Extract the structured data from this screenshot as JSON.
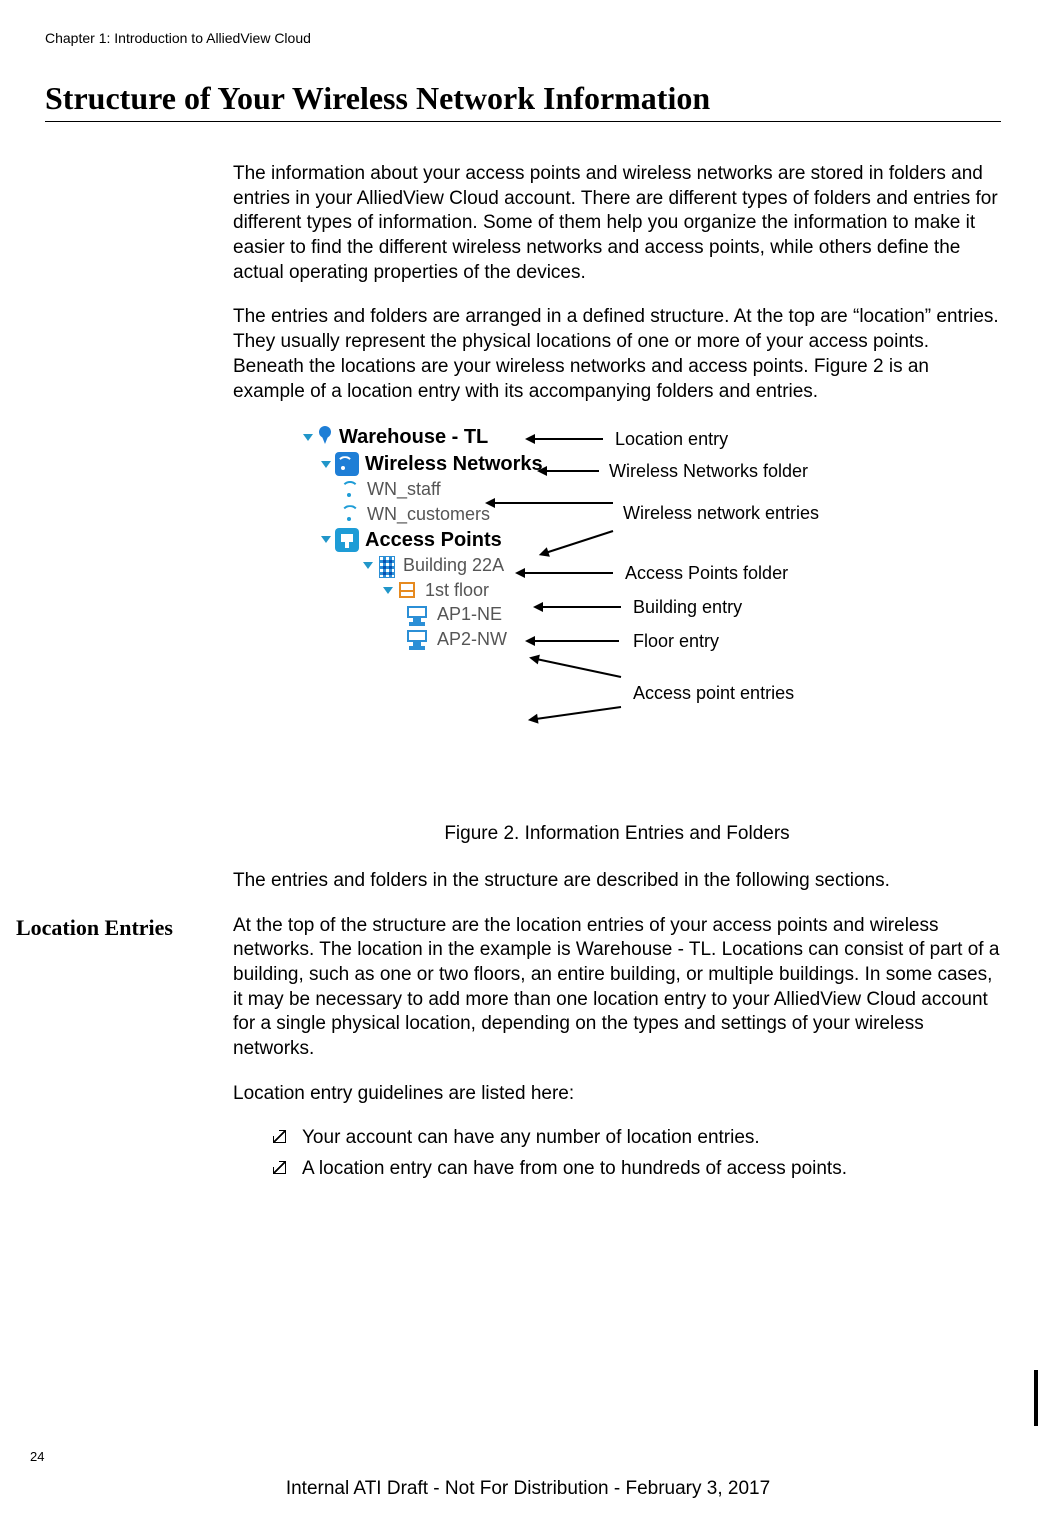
{
  "header": {
    "chapter_line": "Chapter 1: Introduction to AlliedView Cloud"
  },
  "section": {
    "title": "Structure of Your Wireless Network Information"
  },
  "para": {
    "p1": "The information about your access points and wireless networks are stored in folders and entries in your AlliedView Cloud account. There are different types of folders and entries for different types of information. Some of them help you organize the information to make it easier to find the different wireless networks and access points, while others define the actual operating properties of the devices.",
    "p2": "The entries and folders are arranged in a defined structure. At the top are “location” entries. They usually represent the physical locations of one or more of your access points. Beneath the locations are your wireless networks and access points. Figure 2 is an example of a location entry with its accompanying folders and entries.",
    "figcap": "Figure 2. Information Entries and Folders",
    "p3": "The entries and folders in the structure are described in the following sections.",
    "side_loc": "Location Entries",
    "p4": "At the top of the structure are the location entries of your access points and wireless networks. The location in the example is Warehouse - TL. Locations can consist of part of a building, such as one or two floors, an entire building, or multiple buildings. In some cases, it may be necessary to add more than one location entry to your AlliedView Cloud account for a single physical location, depending on the types and settings of your wireless networks.",
    "p5": "Location entry guidelines are listed here:",
    "g1": "Your account can have any number of location entries.",
    "g2": "A location entry can have from one to hundreds of access points."
  },
  "tree": {
    "location": "Warehouse - TL",
    "wireless_networks_folder": "Wireless Networks",
    "wn1": "WN_staff",
    "wn2": "WN_customers",
    "access_points_folder": "Access Points",
    "building": "Building 22A",
    "floor": "1st floor",
    "ap1": "AP1-NE",
    "ap2": "AP2-NW"
  },
  "callouts": {
    "c1": "Location entry",
    "c2": "Wireless Networks folder",
    "c3": "Wireless network entries",
    "c4": "Access Points folder",
    "c5": "Building entry",
    "c6": "Floor entry",
    "c7": "Access point entries"
  },
  "footer": {
    "page": "24",
    "draft": "Internal ATI Draft - Not For Distribution - February 3, 2017"
  }
}
